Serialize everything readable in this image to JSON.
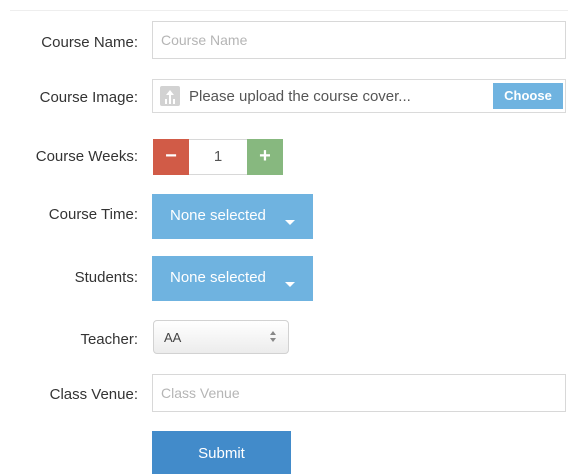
{
  "form": {
    "course_name": {
      "label": "Course Name:",
      "placeholder": "Course Name",
      "value": ""
    },
    "course_image": {
      "label": "Course Image:",
      "file_text": "Please upload the course cover...",
      "button": "Choose",
      "icon": "upload-icon"
    },
    "course_weeks": {
      "label": "Course Weeks:",
      "minus": "−",
      "value": "1",
      "plus": "+"
    },
    "course_time": {
      "label": "Course Time:",
      "selected": "None selected"
    },
    "students": {
      "label": "Students:",
      "selected": "None selected"
    },
    "teacher": {
      "label": "Teacher:",
      "selected": "AA"
    },
    "class_venue": {
      "label": "Class Venue:",
      "placeholder": "Class Venue",
      "value": ""
    },
    "submit": "Submit"
  },
  "colors": {
    "primary_blue": "#428bca",
    "light_blue": "#6fb3e0",
    "minus_red": "#d15b47",
    "plus_green": "#87b87f"
  }
}
